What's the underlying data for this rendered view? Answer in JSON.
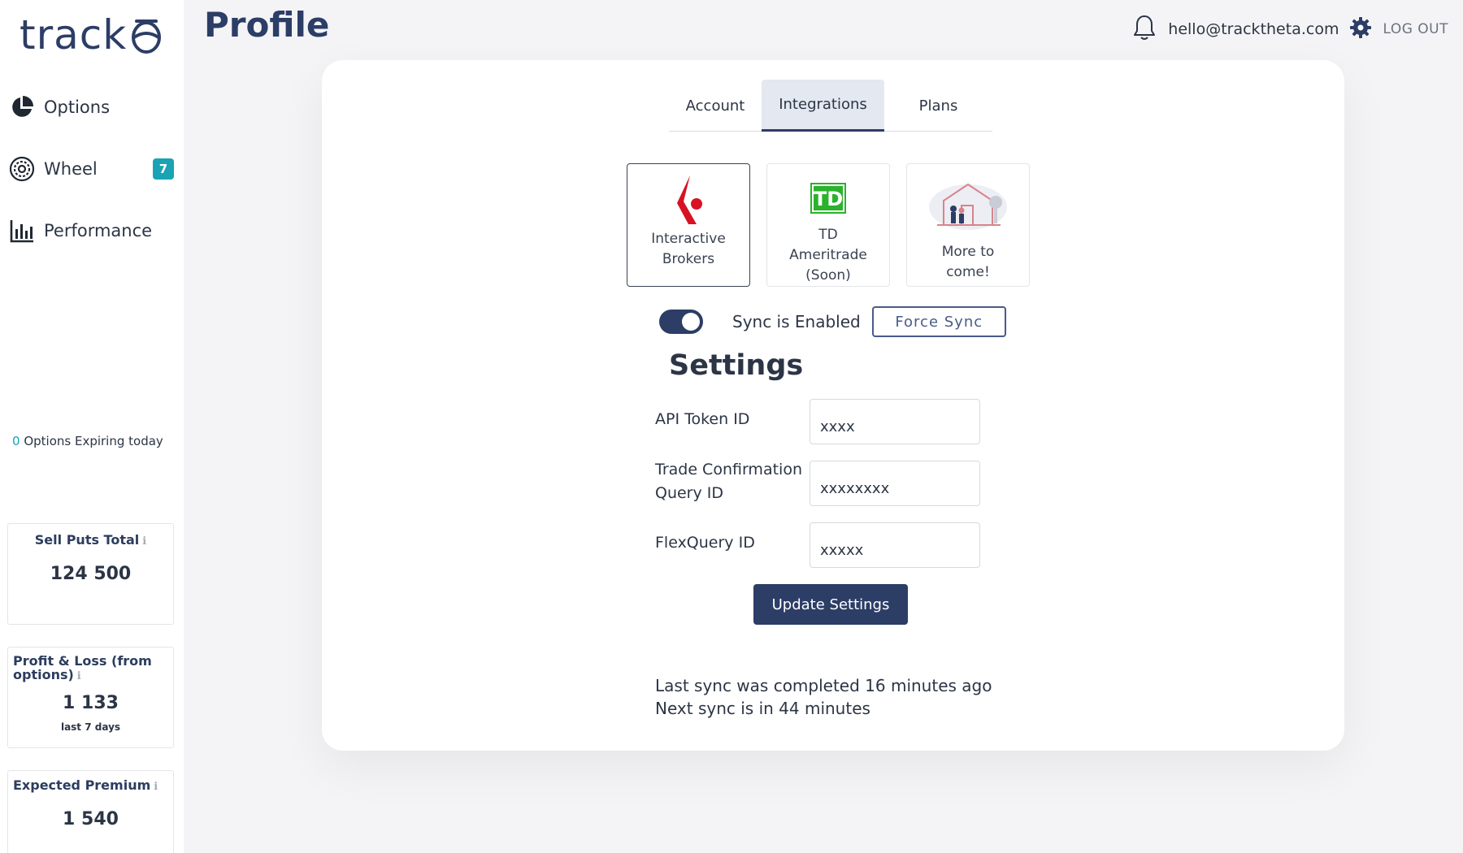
{
  "app": {
    "logo_text": "track"
  },
  "sidebar": {
    "items": [
      {
        "label": "Options",
        "icon": "pie-chart-icon"
      },
      {
        "label": "Wheel",
        "icon": "wheel-icon",
        "badge": "7"
      },
      {
        "label": "Performance",
        "icon": "bar-chart-icon"
      }
    ],
    "expiring": {
      "count": "0",
      "label": "Options Expiring today"
    },
    "stats": [
      {
        "title": "Sell Puts Total",
        "value": "124 500"
      },
      {
        "title": "Profit & Loss (from options)",
        "value": "1 133",
        "sub": "last 7 days"
      },
      {
        "title": "Expected Premium",
        "value": "1 540"
      }
    ]
  },
  "header": {
    "page_title": "Profile",
    "email": "hello@tracktheta.com",
    "logout_label": "LOG OUT"
  },
  "tabs": {
    "account": "Account",
    "integrations": "Integrations",
    "plans": "Plans",
    "active": "Integrations"
  },
  "brokers": [
    {
      "name_line1": "Interactive",
      "name_line2": "Brokers",
      "selected": true
    },
    {
      "name_line1": "TD",
      "name_line2": "Ameritrade",
      "name_line3": "(Soon)",
      "selected": false
    },
    {
      "name_line1": "More to",
      "name_line2": "come!",
      "selected": false
    }
  ],
  "sync": {
    "enabled": true,
    "label": "Sync is Enabled",
    "force_label": "Force Sync"
  },
  "settings": {
    "title": "Settings",
    "fields": [
      {
        "label": "API Token ID",
        "value": "xxxx"
      },
      {
        "label": "Trade Confirmation Query ID",
        "value": "xxxxxxxx"
      },
      {
        "label": "FlexQuery ID",
        "value": "xxxxx"
      }
    ],
    "update_label": "Update Settings"
  },
  "sync_info": {
    "last": "Last sync was completed 16 minutes ago",
    "next": "Next sync is in 44 minutes"
  },
  "colors": {
    "primary": "#2c3d66",
    "accent": "#1aa3b5",
    "ib_red": "#d81222",
    "td_green": "#2bb22c"
  }
}
